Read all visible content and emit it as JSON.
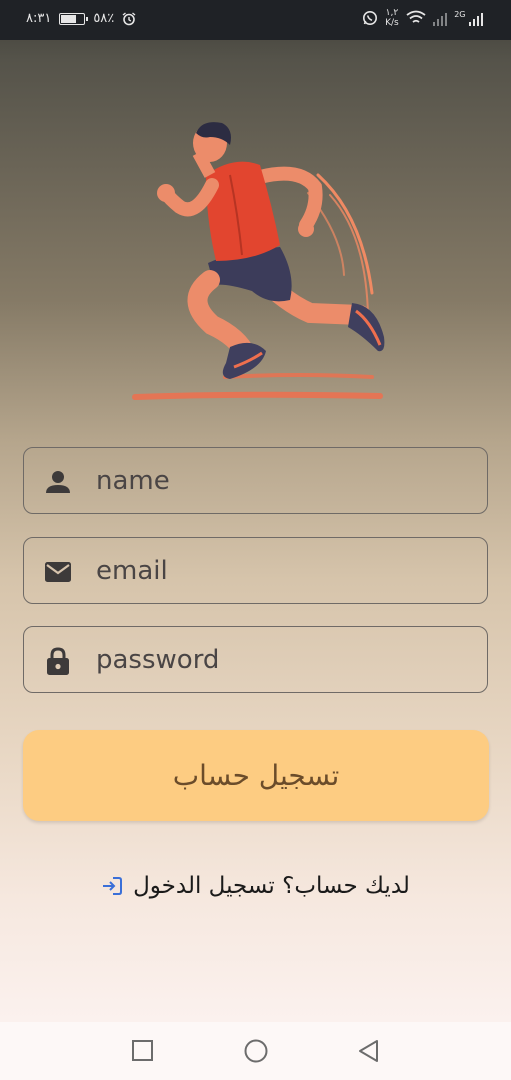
{
  "status_bar": {
    "time": "٨:٣١",
    "battery": "٥٨٪",
    "net_speed_value": "١,٢",
    "net_speed_unit": "K/s",
    "network_type": "2G"
  },
  "hero": {
    "icon": "runner-illustration"
  },
  "form": {
    "name_placeholder": "name",
    "email_placeholder": "email",
    "password_placeholder": "password",
    "name_icon": "person-icon",
    "email_icon": "mail-icon",
    "password_icon": "lock-icon"
  },
  "signup_button_label": "تسجيل حساب",
  "login_link_text": "لديك حساب؟ تسجيل الدخول",
  "colors": {
    "button": "#fdcc82",
    "button_text": "#6b4c2a",
    "login_icon": "#3a6fd8",
    "field_border": "#6f6a66"
  }
}
